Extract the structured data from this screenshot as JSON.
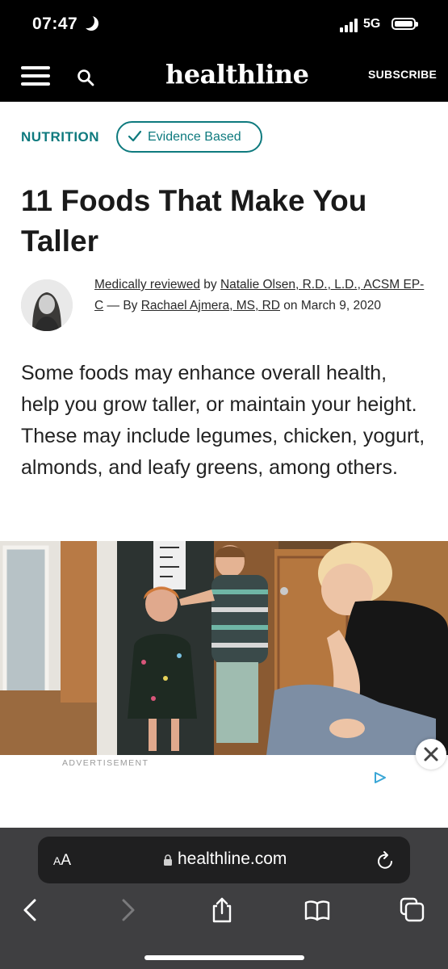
{
  "status_bar": {
    "time": "07:47",
    "network": "5G"
  },
  "nav": {
    "logo": "healthline",
    "subscribe_label": "SUBSCRIBE"
  },
  "article": {
    "category": "NUTRITION",
    "badge": "Evidence Based",
    "title": "11 Foods That Make You Taller",
    "byline": {
      "reviewed_label": "Medically reviewed",
      "by1": " by ",
      "reviewer": "Natalie Olsen, R.D., L.D., ACSM EP-C",
      "sep": " — By ",
      "author": "Rachael Ajmera, MS, RD",
      "on": " on ",
      "date": "March 9, 2020"
    },
    "summary": "Some foods may enhance overall health, help you grow taller, or maintain your height. These may include legumes, chicken, yogurt, almonds, and leafy greens, among others."
  },
  "ad": {
    "label": "ADVERTISEMENT"
  },
  "browser": {
    "aa_small": "A",
    "aa_large": "A",
    "url": "healthline.com"
  },
  "colors": {
    "accent": "#0e7a7e",
    "bar": "#000000",
    "browser_bg": "#3f3f41"
  }
}
